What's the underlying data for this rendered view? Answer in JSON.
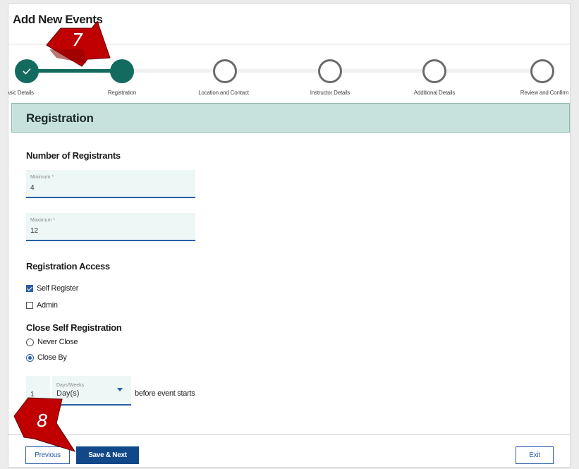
{
  "page": {
    "title": "Add New Events"
  },
  "stepper": {
    "steps": [
      {
        "label": "Basic Details",
        "state": "done"
      },
      {
        "label": "Registration",
        "state": "current"
      },
      {
        "label": "Location and Contact",
        "state": "todo"
      },
      {
        "label": "Instructor Details",
        "state": "todo"
      },
      {
        "label": "Additional Details",
        "state": "todo"
      },
      {
        "label": "Review and Confirm",
        "state": "todo"
      }
    ],
    "check_icon": "check-icon"
  },
  "section": {
    "title": "Registration"
  },
  "registrants": {
    "heading": "Number of Registrants",
    "minimum_label": "Minimum *",
    "minimum_value": "4",
    "maximum_label": "Maximum *",
    "maximum_value": "12"
  },
  "access": {
    "heading": "Registration Access",
    "options": [
      {
        "label": "Self Register",
        "checked": true
      },
      {
        "label": "Admin",
        "checked": false
      }
    ]
  },
  "close_registration": {
    "heading": "Close Self Registration",
    "options": [
      {
        "label": "Never Close",
        "selected": false
      },
      {
        "label": "Close By",
        "selected": true
      }
    ],
    "amount_value": "1",
    "unit_label": "Days/Weeks",
    "unit_value": "Day(s)",
    "suffix": "before event starts"
  },
  "footer": {
    "previous_label": "Previous",
    "save_next_label": "Save & Next",
    "exit_label": "Exit"
  },
  "callouts": {
    "first": "7",
    "second": "8"
  },
  "colors": {
    "step_green": "#136b5f",
    "section_bg": "#c7e2dc",
    "primary_blue": "#10488a",
    "callout_red": "#c00000"
  }
}
